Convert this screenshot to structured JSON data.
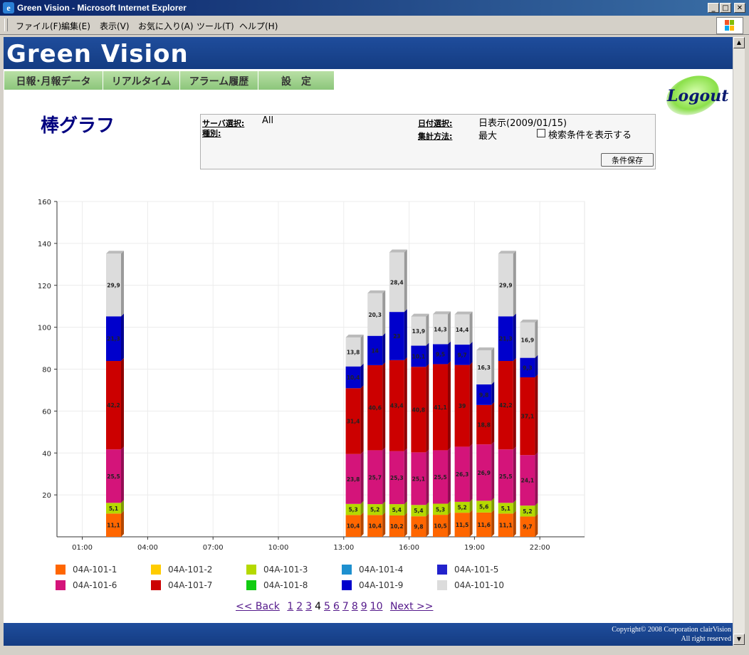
{
  "window": {
    "title": "Green Vision - Microsoft Internet Explorer"
  },
  "menu": [
    "ファイル(F)",
    "編集(E)",
    "表示(V)",
    "お気に入り(A)",
    "ツール(T)",
    "ヘルプ(H)"
  ],
  "header": {
    "brand": "Green Vision"
  },
  "nav": [
    "日報･月報データ",
    "リアルタイム",
    "アラーム履歴",
    "設　定"
  ],
  "logout": "Logout",
  "page_title": "棒グラフ",
  "search": {
    "server_label": "サーバ選択:",
    "server_value": "All",
    "type_label": "種別:",
    "date_label": "日付選択:",
    "date_value": "日表示(2009/01/15)",
    "agg_label": "集計方法:",
    "agg_value": "最大",
    "show_cond_label": "検索条件を表示する",
    "save_label": "条件保存"
  },
  "pager": {
    "back": "<< Back",
    "pages": [
      "1",
      "2",
      "3",
      "4",
      "5",
      "6",
      "7",
      "8",
      "9",
      "10"
    ],
    "current": "4",
    "next": "Next >>"
  },
  "footer": {
    "line1": "Copyright© 2008 Corporation clairVision",
    "line2": "All right reserved"
  },
  "chart_data": {
    "type": "bar",
    "stacked": true,
    "ylim": [
      0,
      160
    ],
    "yticks": [
      20,
      40,
      60,
      80,
      100,
      120,
      140,
      160
    ],
    "xticks": [
      "01:00",
      "04:00",
      "07:00",
      "10:00",
      "13:00",
      "16:00",
      "19:00",
      "22:00"
    ],
    "grid": true,
    "legend_position": "bottom",
    "series": [
      {
        "name": "04A-101-1",
        "color": "#ff6600"
      },
      {
        "name": "04A-101-2",
        "color": "#ffcc00"
      },
      {
        "name": "04A-101-3",
        "color": "#b5d900"
      },
      {
        "name": "04A-101-4",
        "color": "#1e90cf"
      },
      {
        "name": "04A-101-5",
        "color": "#2222cc"
      },
      {
        "name": "04A-101-6",
        "color": "#d4147a"
      },
      {
        "name": "04A-101-7",
        "color": "#cc0000"
      },
      {
        "name": "04A-101-8",
        "color": "#11cc11"
      },
      {
        "name": "04A-101-9",
        "color": "#0000cc"
      },
      {
        "name": "04A-101-10",
        "color": "#dcdcdc"
      }
    ],
    "bars": [
      {
        "hour": 2,
        "segments": [
          {
            "series": 0,
            "value": 11.1,
            "label": "11,1"
          },
          {
            "series": 2,
            "value": 5.1,
            "label": "5,1"
          },
          {
            "series": 5,
            "value": 25.5,
            "label": "25,5"
          },
          {
            "series": 6,
            "value": 42.2,
            "label": "42,2"
          },
          {
            "series": 8,
            "value": 21.3,
            "label": "21,3"
          },
          {
            "series": 9,
            "value": 29.9,
            "label": "29,9"
          }
        ]
      },
      {
        "hour": 13,
        "segments": [
          {
            "series": 0,
            "value": 10.4,
            "label": "10,4"
          },
          {
            "series": 2,
            "value": 5.3,
            "label": "5,3"
          },
          {
            "series": 5,
            "value": 23.8,
            "label": "23,8"
          },
          {
            "series": 6,
            "value": 31.4,
            "label": "31,4"
          },
          {
            "series": 8,
            "value": 10.4,
            "label": "10,4"
          },
          {
            "series": 9,
            "value": 13.8,
            "label": "13,8"
          }
        ]
      },
      {
        "hour": 14,
        "segments": [
          {
            "series": 0,
            "value": 10.4,
            "label": "10,4"
          },
          {
            "series": 2,
            "value": 5.2,
            "label": "5,2"
          },
          {
            "series": 5,
            "value": 25.7,
            "label": "25,7"
          },
          {
            "series": 6,
            "value": 40.6,
            "label": "40,6"
          },
          {
            "series": 8,
            "value": 14,
            "label": "14"
          },
          {
            "series": 9,
            "value": 20.3,
            "label": "20,3"
          }
        ]
      },
      {
        "hour": 15,
        "segments": [
          {
            "series": 0,
            "value": 10.2,
            "label": "10,2"
          },
          {
            "series": 2,
            "value": 5.4,
            "label": "5,4"
          },
          {
            "series": 5,
            "value": 25.3,
            "label": "25,3"
          },
          {
            "series": 6,
            "value": 43.4,
            "label": "43,4"
          },
          {
            "series": 8,
            "value": 23,
            "label": "23"
          },
          {
            "series": 9,
            "value": 28.4,
            "label": "28,4"
          }
        ]
      },
      {
        "hour": 16,
        "segments": [
          {
            "series": 0,
            "value": 9.8,
            "label": "9,8"
          },
          {
            "series": 2,
            "value": 5.4,
            "label": "5,4"
          },
          {
            "series": 5,
            "value": 25.1,
            "label": "25,1"
          },
          {
            "series": 6,
            "value": 40.8,
            "label": "40,8"
          },
          {
            "series": 8,
            "value": 10.1,
            "label": "10,1"
          },
          {
            "series": 9,
            "value": 13.9,
            "label": "13,9"
          }
        ]
      },
      {
        "hour": 17,
        "segments": [
          {
            "series": 0,
            "value": 10.5,
            "label": "10,5"
          },
          {
            "series": 2,
            "value": 5.3,
            "label": "5,3"
          },
          {
            "series": 5,
            "value": 25.5,
            "label": "25,5"
          },
          {
            "series": 6,
            "value": 41.1,
            "label": "41,1"
          },
          {
            "series": 8,
            "value": 9.5,
            "label": "9,5"
          },
          {
            "series": 9,
            "value": 14.3,
            "label": "14,3"
          }
        ]
      },
      {
        "hour": 18,
        "segments": [
          {
            "series": 0,
            "value": 11.5,
            "label": "11,5"
          },
          {
            "series": 2,
            "value": 5.2,
            "label": "5,2"
          },
          {
            "series": 5,
            "value": 26.3,
            "label": "26,3"
          },
          {
            "series": 6,
            "value": 39,
            "label": "39"
          },
          {
            "series": 8,
            "value": 9.7,
            "label": "9,7"
          },
          {
            "series": 9,
            "value": 14.4,
            "label": "14,4"
          }
        ]
      },
      {
        "hour": 19,
        "segments": [
          {
            "series": 0,
            "value": 11.6,
            "label": "11,6"
          },
          {
            "series": 2,
            "value": 5.6,
            "label": "5,6"
          },
          {
            "series": 5,
            "value": 26.9,
            "label": "26,9"
          },
          {
            "series": 6,
            "value": 18.8,
            "label": "18,8"
          },
          {
            "series": 8,
            "value": 9.8,
            "label": "9,8"
          },
          {
            "series": 9,
            "value": 16.3,
            "label": "16,3"
          }
        ]
      },
      {
        "hour": 20,
        "segments": [
          {
            "series": 0,
            "value": 11.1,
            "label": "11,1"
          },
          {
            "series": 2,
            "value": 5.1,
            "label": "5,1"
          },
          {
            "series": 5,
            "value": 25.5,
            "label": "25,5"
          },
          {
            "series": 6,
            "value": 42.2,
            "label": "42,2"
          },
          {
            "series": 8,
            "value": 21.3,
            "label": "21,3"
          },
          {
            "series": 9,
            "value": 29.9,
            "label": "29,9"
          }
        ]
      },
      {
        "hour": 21,
        "segments": [
          {
            "series": 0,
            "value": 9.7,
            "label": "9,7"
          },
          {
            "series": 2,
            "value": 5.2,
            "label": "5,2"
          },
          {
            "series": 5,
            "value": 24.1,
            "label": "24,1"
          },
          {
            "series": 6,
            "value": 37.1,
            "label": "37,1"
          },
          {
            "series": 8,
            "value": 9.3,
            "label": "9,3"
          },
          {
            "series": 9,
            "value": 16.9,
            "label": "16,9"
          }
        ]
      }
    ]
  }
}
